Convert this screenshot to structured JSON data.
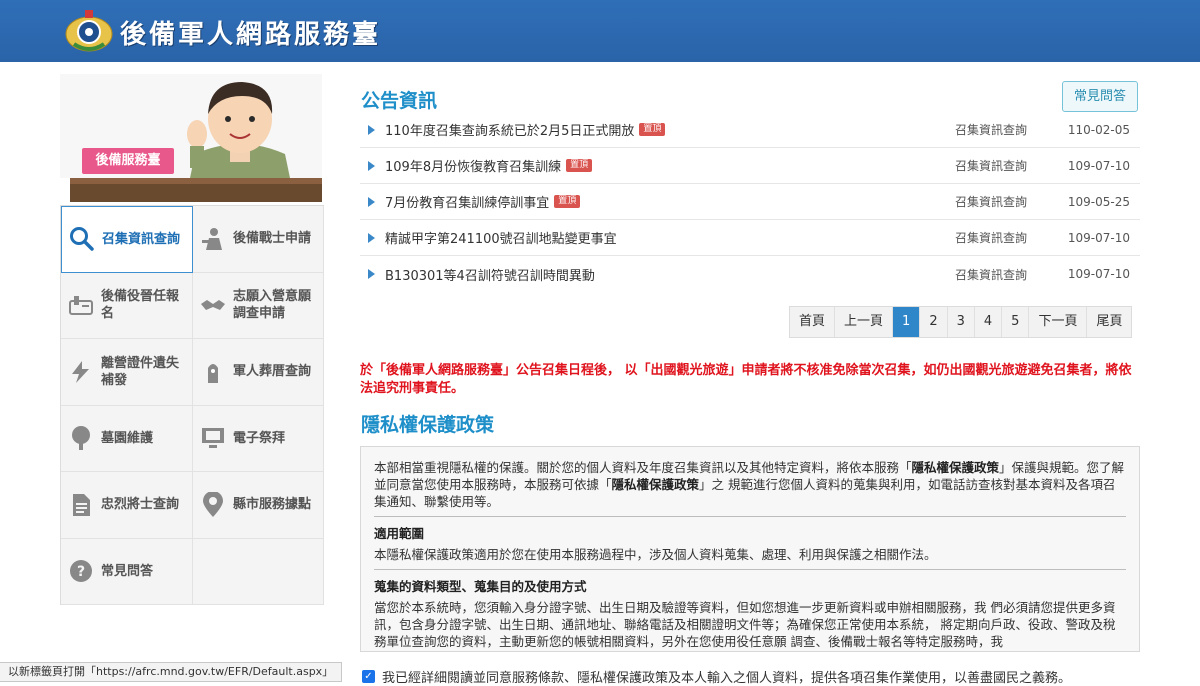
{
  "header": {
    "site_title": "後備軍人網路服務臺"
  },
  "hero": {
    "sign": "後備服務臺"
  },
  "nav": [
    {
      "label": "召集資訊查詢",
      "icon": "search-icon",
      "active": true
    },
    {
      "label": "後備戰士申請",
      "icon": "soldier-icon",
      "active": false
    },
    {
      "label": "後備役晉任報名",
      "icon": "badge-icon",
      "active": false
    },
    {
      "label": "志願入營意願調查申請",
      "icon": "handshake-icon",
      "active": false
    },
    {
      "label": "離營證件遺失補發",
      "icon": "lightning-icon",
      "active": false
    },
    {
      "label": "軍人葬厝查詢",
      "icon": "tombstone-icon",
      "active": false
    },
    {
      "label": "墓園維護",
      "icon": "tree-icon",
      "active": false
    },
    {
      "label": "電子祭拜",
      "icon": "monitor-icon",
      "active": false
    },
    {
      "label": "忠烈將士查詢",
      "icon": "document-icon",
      "active": false
    },
    {
      "label": "縣市服務據點",
      "icon": "map-pin-icon",
      "active": false
    },
    {
      "label": "常見問答",
      "icon": "question-icon",
      "active": false
    }
  ],
  "announcements": {
    "title": "公告資訊",
    "faq_button": "常見問答",
    "top_tag": "置頂",
    "rows": [
      {
        "text": "110年度召集查詢系統已於2月5日正式開放",
        "pinned": true,
        "category": "召集資訊查詢",
        "date": "110-02-05"
      },
      {
        "text": "109年8月份恢復教育召集訓練",
        "pinned": true,
        "category": "召集資訊查詢",
        "date": "109-07-10"
      },
      {
        "text": "7月份教育召集訓練停訓事宜",
        "pinned": true,
        "category": "召集資訊查詢",
        "date": "109-05-25"
      },
      {
        "text": "精誠甲字第241100號召訓地點變更事宜",
        "pinned": false,
        "category": "召集資訊查詢",
        "date": "109-07-10"
      },
      {
        "text": "B130301等4召訓符號召訓時間異動",
        "pinned": false,
        "category": "召集資訊查詢",
        "date": "109-07-10"
      }
    ]
  },
  "pager": {
    "first": "首頁",
    "prev": "上一頁",
    "pages": [
      "1",
      "2",
      "3",
      "4",
      "5"
    ],
    "current": "1",
    "next": "下一頁",
    "last": "尾頁"
  },
  "warning": "於「後備軍人網路服務臺」公告召集日程後， 以「出國觀光旅遊」申請者將不核准免除當次召集，如仍出國觀光旅遊避免召集者，將依法追究刑事責任。",
  "privacy": {
    "title": "隱私權保護政策",
    "intro_1": "本部相當重視隱私權的保護。關於您的個人資料及年度召集資訊以及其他特定資料，將依本服務「",
    "policy_name": "隱私權保護政策",
    "intro_2": "」保護與規範。您了解並同意當您使用本服務時，本服務可依據「",
    "intro_3": "」之 規範進行您個人資料的蒐集與利用，如電話訪查核對基本資料及各項召集通知、聯繫使用等。",
    "scope_title": "適用範圍",
    "scope_text": "本隱私權保護政策適用於您在使用本服務過程中，涉及個人資料蒐集、處理、利用與保護之相關作法。",
    "collect_title": "蒐集的資料類型、蒐集目的及使用方式",
    "collect_text": "當您於本系統時，您須輸入身分證字號、出生日期及驗證等資料，但如您想進一步更新資料或申辦相關服務，我 們必須請您提供更多資訊，包含身分證字號、出生日期、通訊地址、聯絡電話及相關證明文件等；為確保您正常使用本系統， 將定期向戶政、役政、警政及稅務單位查詢您的資料，主動更新您的帳號相關資料，另外在您使用役任意願 調查、後備戰士報名等特定服務時，我"
  },
  "agree_text": "我已經詳細閱讀並同意服務條款、隱私權保護政策及本人輸入之個人資料，提供各項召集作業使用，以善盡國民之義務。",
  "statusbar": "以新標籤頁打開「https://afrc.mnd.gov.tw/EFR/Default.aspx」"
}
